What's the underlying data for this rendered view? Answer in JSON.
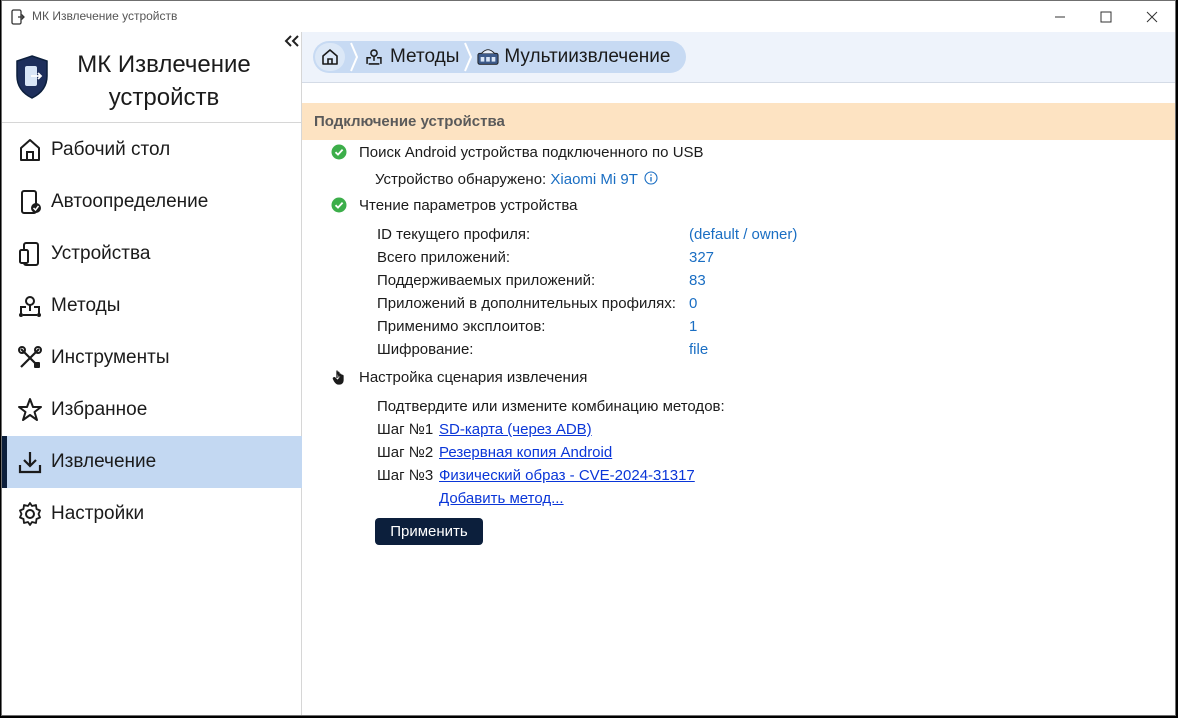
{
  "window": {
    "title": "МК Извлечение устройств"
  },
  "sidebar": {
    "brand_name": "МК Извлечение устройств",
    "items": [
      {
        "label": "Рабочий стол",
        "icon": "home-icon"
      },
      {
        "label": "Автоопределение",
        "icon": "device-check-icon"
      },
      {
        "label": "Устройства",
        "icon": "devices-icon"
      },
      {
        "label": "Методы",
        "icon": "methods-icon"
      },
      {
        "label": "Инструменты",
        "icon": "tools-icon"
      },
      {
        "label": "Избранное",
        "icon": "star-icon"
      },
      {
        "label": "Извлечение",
        "icon": "download-icon",
        "active": true
      },
      {
        "label": "Настройки",
        "icon": "gear-icon"
      }
    ]
  },
  "breadcrumb": {
    "items": [
      {
        "label": "Методы",
        "icon": "methods-icon"
      },
      {
        "label": "Мультиизвлечение",
        "icon": "multi-extract-icon"
      }
    ]
  },
  "section": {
    "title": "Подключение устройства"
  },
  "steps": {
    "search": {
      "title": "Поиск Android устройства подключенного по USB",
      "detected_label": "Устройство обнаружено:",
      "detected_device": "Xiaomi Mi 9T"
    },
    "params": {
      "title": "Чтение параметров устройства",
      "rows": [
        {
          "label": "ID текущего профиля:",
          "value": "(default / owner)"
        },
        {
          "label": "Всего приложений:",
          "value": "327"
        },
        {
          "label": "Поддерживаемых приложений:",
          "value": "83"
        },
        {
          "label": "Приложений в дополнительных профилях:",
          "value": "0"
        },
        {
          "label": "Применимо эксплоитов:",
          "value": "1"
        },
        {
          "label": "Шифрование:",
          "value": "file"
        }
      ]
    },
    "scenario": {
      "title": "Настройка сценария извлечения",
      "prompt": "Подтвердите или измените комбинацию методов:",
      "steps": [
        {
          "label": "Шаг №1",
          "method": "SD-карта (через ADB)"
        },
        {
          "label": "Шаг №2",
          "method": "Резервная копия Android"
        },
        {
          "label": "Шаг №3",
          "method": "Физический образ - CVE-2024-31317"
        }
      ],
      "add_method": "Добавить метод...",
      "apply_label": "Применить"
    }
  },
  "colors": {
    "accent_dark": "#0c1f3c",
    "active_nav": "#c3d8f2",
    "section_header": "#fde3c2",
    "success": "#3cae4a",
    "link": "#1a6ec3"
  }
}
